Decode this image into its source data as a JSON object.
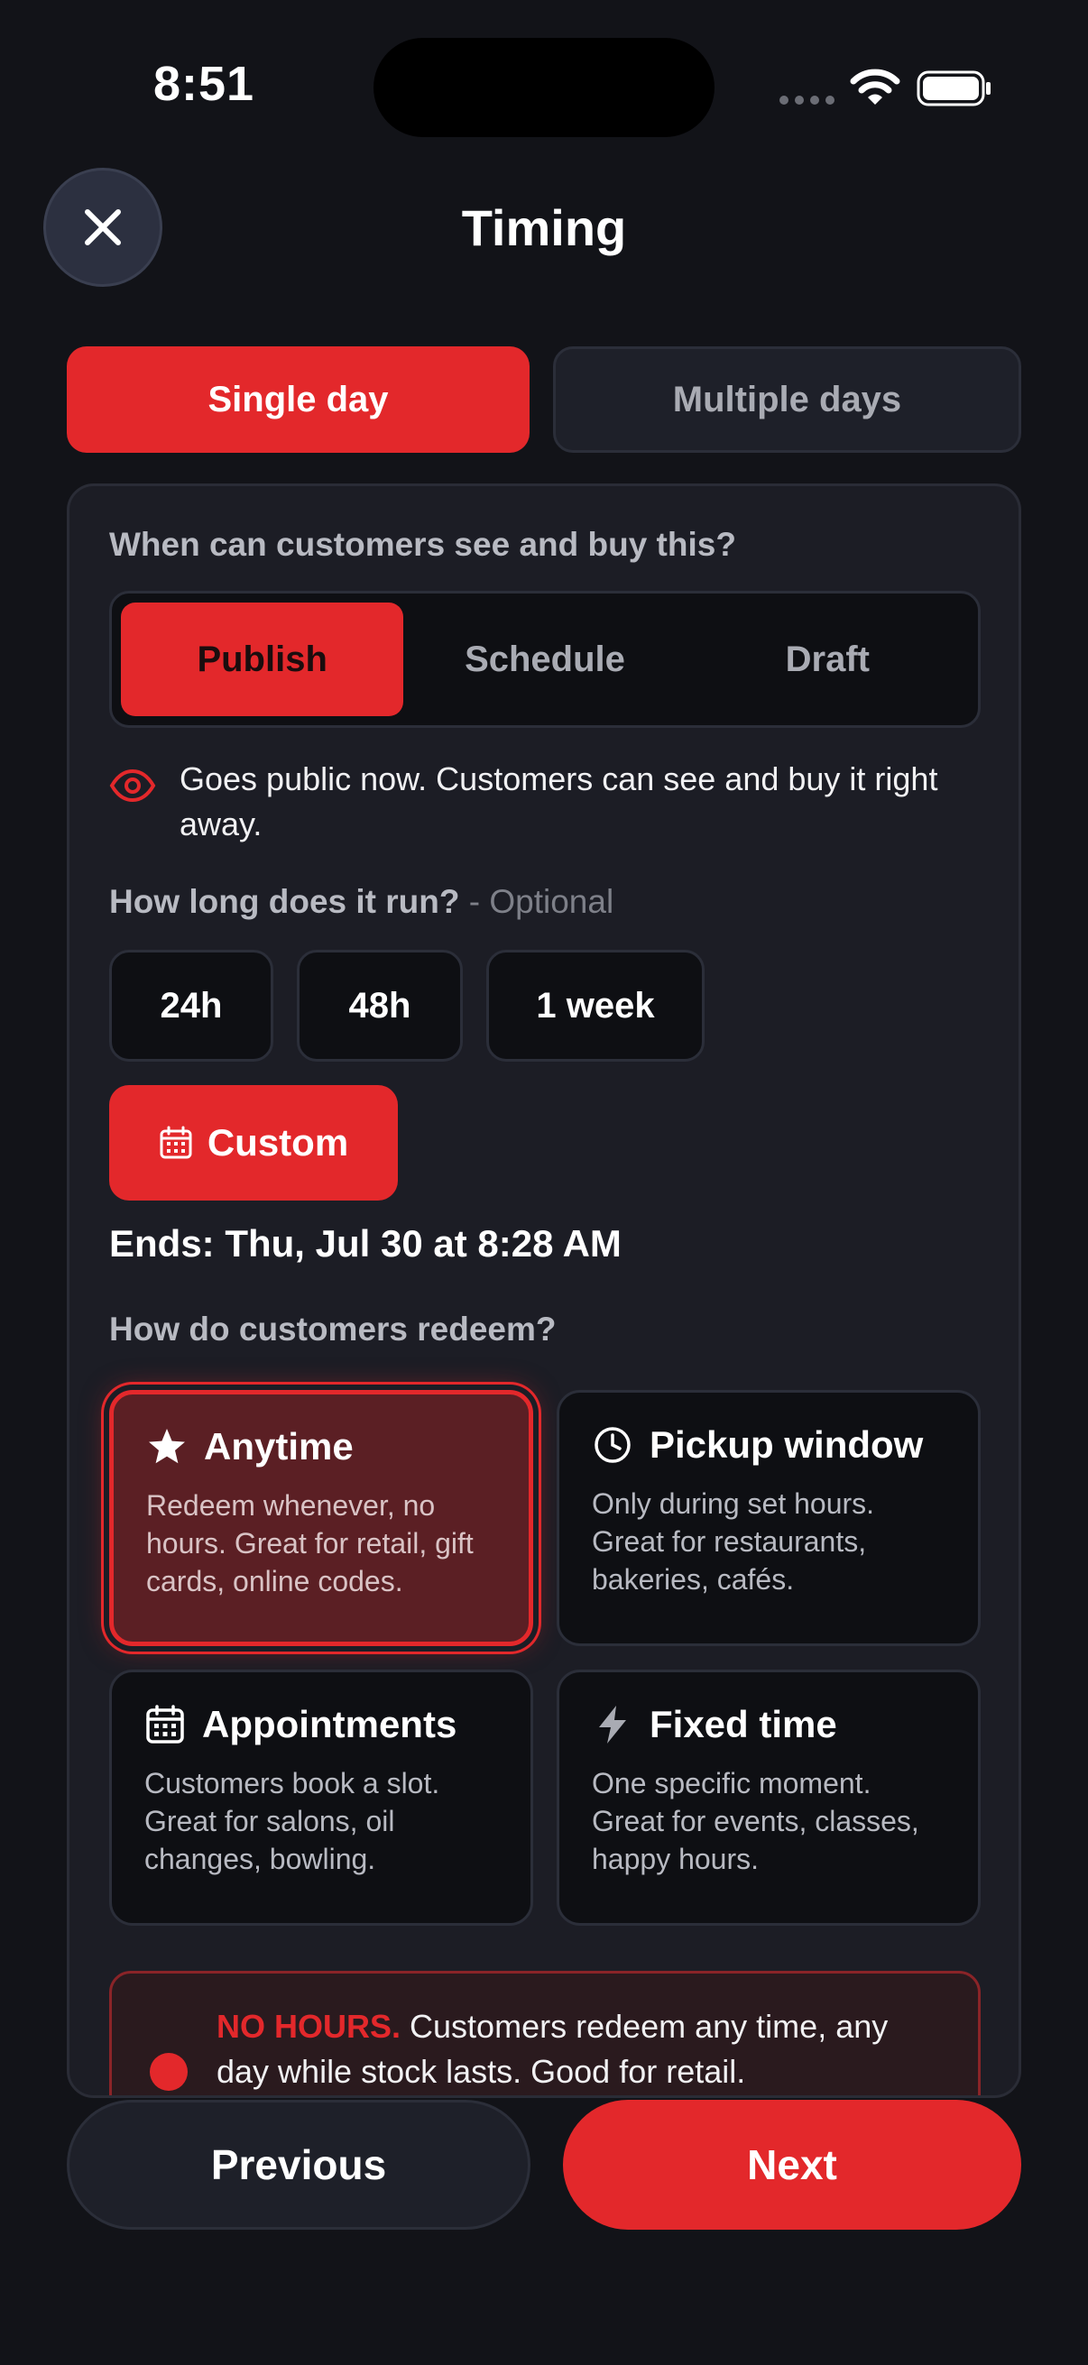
{
  "status_bar": {
    "time": "8:51"
  },
  "header": {
    "title": "Timing"
  },
  "day_toggle": {
    "single": "Single day",
    "multiple": "Multiple days",
    "selected": "single"
  },
  "visibility": {
    "question": "When can customers see and buy this?",
    "options": [
      "Publish",
      "Schedule",
      "Draft"
    ],
    "selected": "Publish",
    "notice": "Goes public now. Customers can see and buy it right away."
  },
  "duration": {
    "question": "How long does it run?",
    "optional_label": "- Optional",
    "options": [
      "24h",
      "48h",
      "1 week"
    ],
    "custom_label": "Custom",
    "ends_text": "Ends: Thu, Jul 30 at 8:28 AM"
  },
  "redeem": {
    "question": "How do customers redeem?",
    "options": [
      {
        "title": "Anytime",
        "desc": "Redeem whenever, no hours. Great for retail, gift cards, online codes.",
        "icon": "star-icon"
      },
      {
        "title": "Pickup window",
        "desc": "Only during set hours. Great for restaurants, bakeries, cafés.",
        "icon": "clock-icon"
      },
      {
        "title": "Appointments",
        "desc": "Customers book a slot. Great for salons, oil changes, bowling.",
        "icon": "calendar-icon"
      },
      {
        "title": "Fixed time",
        "desc": "One specific moment. Great for events, classes, happy hours.",
        "icon": "bolt-icon"
      }
    ],
    "selected": "Anytime",
    "warning_strong": "NO HOURS.",
    "warning_text": "Customers redeem any time, any day while stock lasts. Good for retail."
  },
  "footer": {
    "previous": "Previous",
    "next": "Next"
  },
  "colors": {
    "accent": "#e3282b",
    "background": "#121318",
    "card": "#1c1d25"
  }
}
